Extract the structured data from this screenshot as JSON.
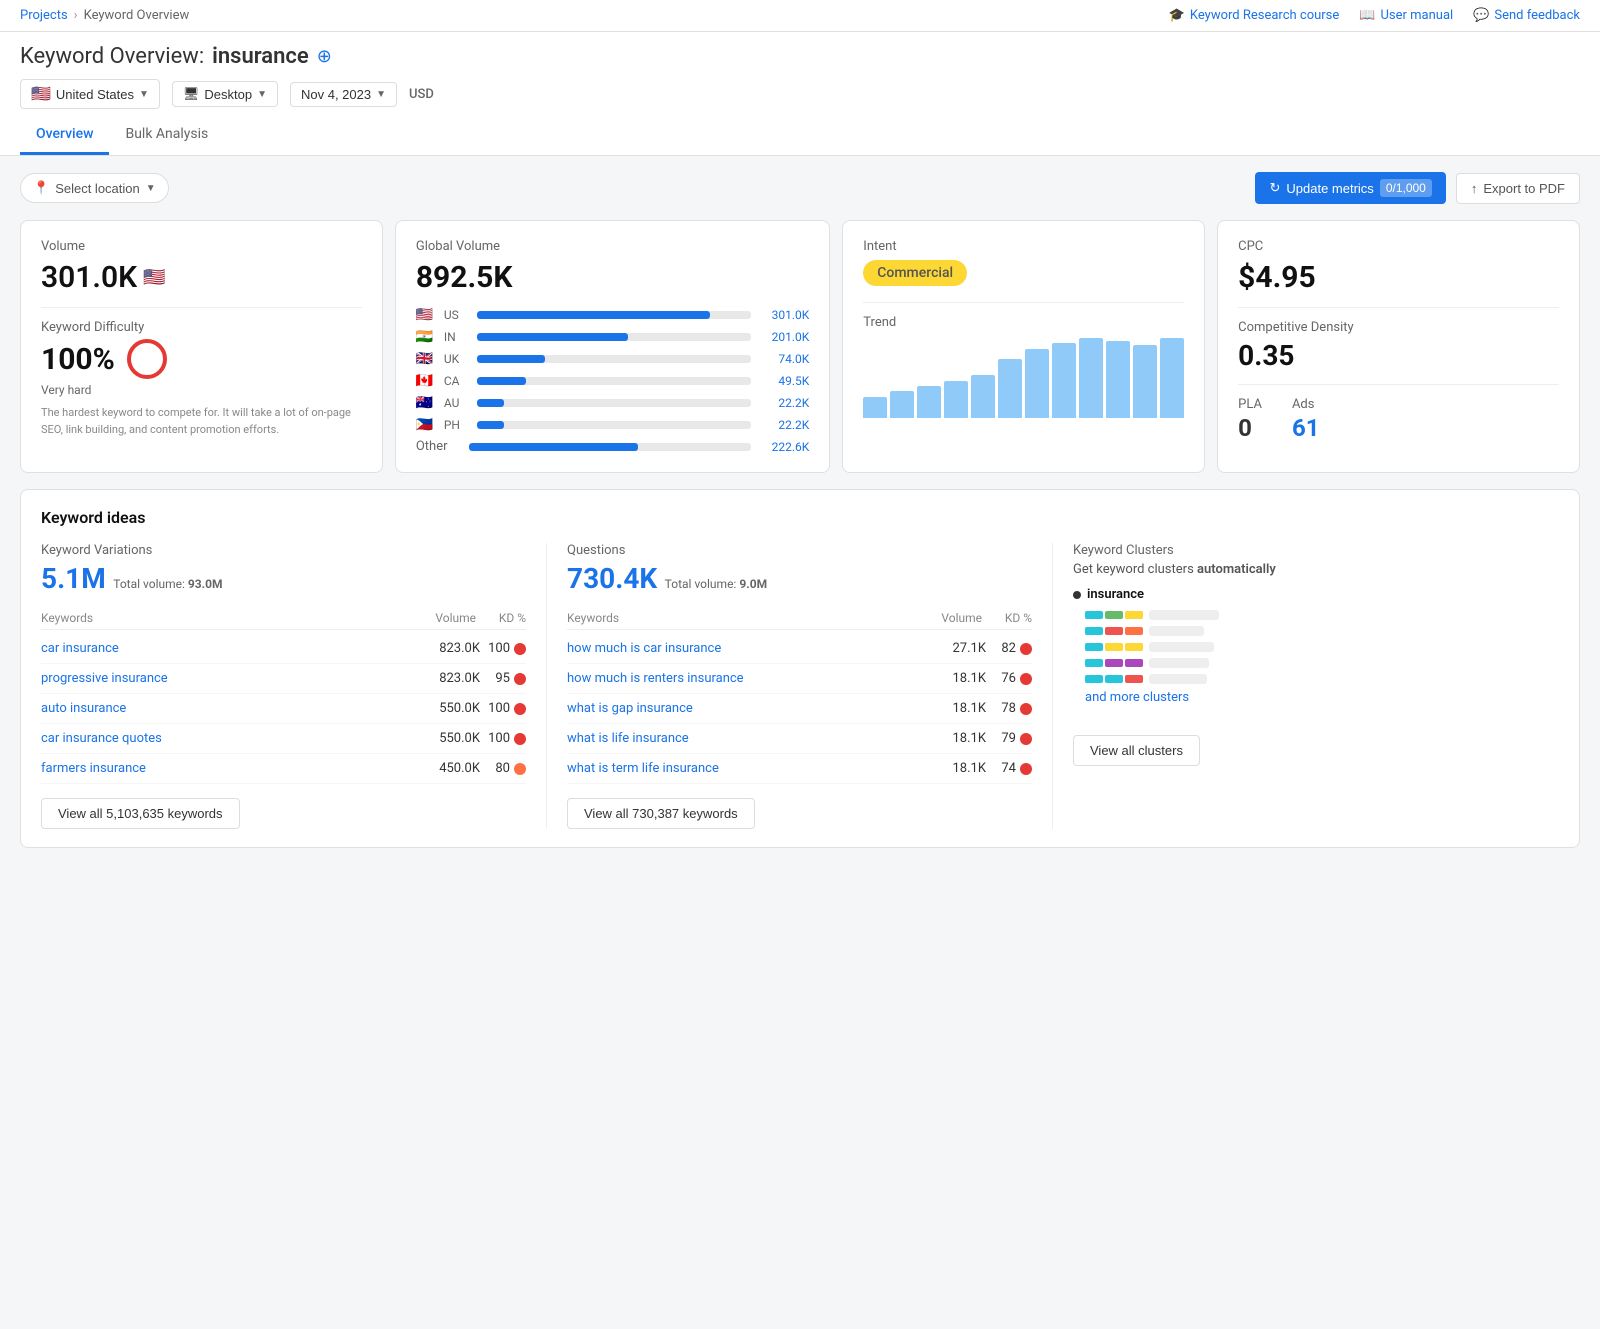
{
  "topBar": {
    "breadcrumbs": [
      "Projects",
      "Keyword Overview"
    ],
    "links": [
      {
        "label": "Keyword Research course",
        "icon": "graduation-cap-icon"
      },
      {
        "label": "User manual",
        "icon": "book-icon"
      },
      {
        "label": "Send feedback",
        "icon": "chat-icon"
      }
    ]
  },
  "header": {
    "title_static": "Keyword Overview:",
    "keyword": "insurance",
    "location": "United States",
    "device": "Desktop",
    "date": "Nov 4, 2023",
    "currency": "USD"
  },
  "tabs": [
    "Overview",
    "Bulk Analysis"
  ],
  "activeTab": "Overview",
  "toolbar": {
    "location_placeholder": "Select location",
    "update_label": "Update metrics",
    "counter": "0/1,000",
    "export_label": "Export to PDF"
  },
  "metrics": {
    "volume": {
      "label": "Volume",
      "value": "301.0K",
      "kd_label": "Keyword Difficulty",
      "kd_value": "100%",
      "kd_difficulty": "Very hard",
      "kd_desc": "The hardest keyword to compete for. It will take a lot of on-page SEO, link building, and content promotion efforts."
    },
    "globalVolume": {
      "label": "Global Volume",
      "value": "892.5K",
      "countries": [
        {
          "flag": "🇺🇸",
          "code": "US",
          "value": "301.0K",
          "pct": 85
        },
        {
          "flag": "🇮🇳",
          "code": "IN",
          "value": "201.0K",
          "pct": 55
        },
        {
          "flag": "🇬🇧",
          "code": "UK",
          "value": "74.0K",
          "pct": 25
        },
        {
          "flag": "🇨🇦",
          "code": "CA",
          "value": "49.5K",
          "pct": 18
        },
        {
          "flag": "🇦🇺",
          "code": "AU",
          "value": "22.2K",
          "pct": 10
        },
        {
          "flag": "🇵🇭",
          "code": "PH",
          "value": "22.2K",
          "pct": 10
        }
      ],
      "other_label": "Other",
      "other_value": "222.6K",
      "other_pct": 60
    },
    "intent": {
      "label": "Intent",
      "value": "Commercial"
    },
    "trend": {
      "label": "Trend",
      "bars": [
        20,
        25,
        30,
        35,
        40,
        55,
        65,
        70,
        75,
        72,
        68,
        75
      ]
    },
    "cpc": {
      "label": "CPC",
      "value": "$4.95",
      "comp_density_label": "Competitive Density",
      "comp_density_value": "0.35",
      "pla_label": "PLA",
      "pla_value": "0",
      "ads_label": "Ads",
      "ads_value": "61"
    }
  },
  "keywordIdeas": {
    "section_title": "Keyword ideas",
    "variations": {
      "col_title": "Keyword Variations",
      "count": "5.1M",
      "total_vol_label": "Total volume:",
      "total_vol": "93.0M",
      "columns": [
        "Keywords",
        "Volume",
        "KD %"
      ],
      "rows": [
        {
          "name": "car insurance",
          "volume": "823.0K",
          "kd": 100,
          "kd_color": "red"
        },
        {
          "name": "progressive insurance",
          "volume": "823.0K",
          "kd": 95,
          "kd_color": "red"
        },
        {
          "name": "auto insurance",
          "volume": "550.0K",
          "kd": 100,
          "kd_color": "red"
        },
        {
          "name": "car insurance quotes",
          "volume": "550.0K",
          "kd": 100,
          "kd_color": "red"
        },
        {
          "name": "farmers insurance",
          "volume": "450.0K",
          "kd": 80,
          "kd_color": "orange"
        }
      ],
      "view_all_label": "View all 5,103,635 keywords"
    },
    "questions": {
      "col_title": "Questions",
      "count": "730.4K",
      "total_vol_label": "Total volume:",
      "total_vol": "9.0M",
      "columns": [
        "Keywords",
        "Volume",
        "KD %"
      ],
      "rows": [
        {
          "name": "how much is car insurance",
          "volume": "27.1K",
          "kd": 82,
          "kd_color": "red"
        },
        {
          "name": "how much is renters insurance",
          "volume": "18.1K",
          "kd": 76,
          "kd_color": "red"
        },
        {
          "name": "what is gap insurance",
          "volume": "18.1K",
          "kd": 78,
          "kd_color": "red"
        },
        {
          "name": "what is life insurance",
          "volume": "18.1K",
          "kd": 79,
          "kd_color": "red"
        },
        {
          "name": "what is term life insurance",
          "volume": "18.1K",
          "kd": 74,
          "kd_color": "red"
        }
      ],
      "view_all_label": "View all 730,387 keywords"
    },
    "clusters": {
      "col_title": "Keyword Clusters",
      "desc_pre": "Get keyword clusters",
      "desc_bold": "automatically",
      "root": "insurance",
      "items": [
        {
          "colors": [
            "#26c6da",
            "#66bb6a",
            "#fdd835"
          ]
        },
        {
          "colors": [
            "#26c6da",
            "#ef5350",
            "#ff7043"
          ]
        },
        {
          "colors": [
            "#26c6da",
            "#fdd835",
            "#fdd835"
          ]
        },
        {
          "colors": [
            "#26c6da",
            "#ab47bc",
            "#ab47bc"
          ]
        },
        {
          "colors": [
            "#26c6da",
            "#26c6da",
            "#ef5350"
          ]
        }
      ],
      "and_more_label": "and more clusters",
      "view_all_label": "View all clusters"
    }
  }
}
